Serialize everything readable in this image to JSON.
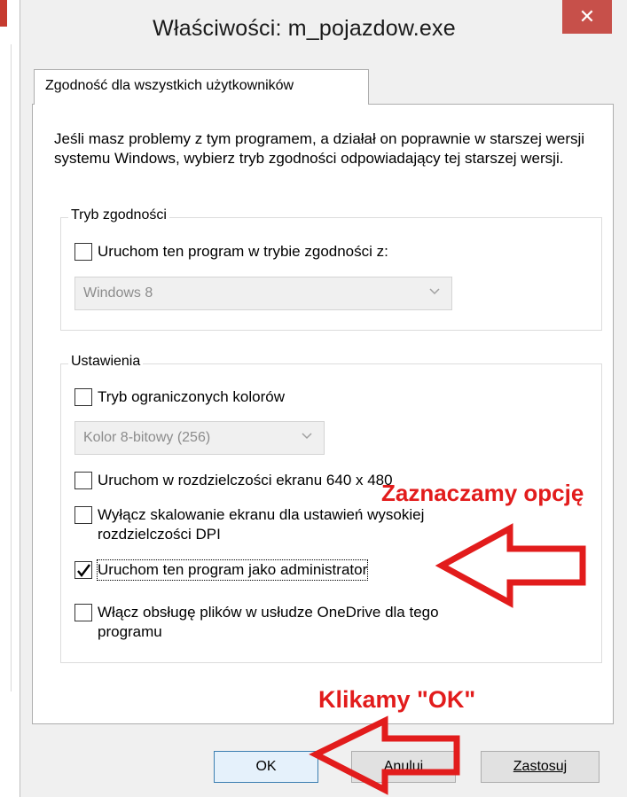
{
  "dialog": {
    "title": "Właściwości: m_pojazdow.exe",
    "close_glyph": "✕",
    "tab_label": "Zgodność dla wszystkich użytkowników",
    "intro_text": "Jeśli masz problemy z tym programem, a działał on poprawnie w starszej wersji systemu Windows, wybierz tryb zgodności odpowiadający tej starszej wersji."
  },
  "compat_group": {
    "legend": "Tryb zgodności",
    "run_compat_label": "Uruchom ten program w trybie zgodności z:",
    "run_compat_checked": false,
    "os_select_value": "Windows 8"
  },
  "settings_group": {
    "legend": "Ustawienia",
    "reduced_color_label": "Tryb ograniczonych kolorów",
    "reduced_color_checked": false,
    "color_select_value": "Kolor 8-bitowy (256)",
    "res640_label": "Uruchom w rozdzielczości ekranu 640 x 480",
    "res640_checked": false,
    "dpi_label": "Wyłącz skalowanie ekranu dla ustawień wysokiej rozdzielczości DPI",
    "dpi_checked": false,
    "admin_label": "Uruchom ten program jako administrator",
    "admin_checked": true,
    "onedrive_label": "Włącz obsługę plików w usłudze OneDrive dla tego programu",
    "onedrive_checked": false
  },
  "buttons": {
    "ok": "OK",
    "cancel": "Anuluj",
    "apply": "Zastosuj"
  },
  "annotations": {
    "select_option": "Zaznaczamy opcję",
    "click_ok": "Klikamy \"OK\"",
    "color": "#e21c1c"
  },
  "icons": {
    "close": "close-icon",
    "chevron": "chevron-down-icon",
    "check": "checkmark-icon",
    "arrow": "arrow-left-icon"
  }
}
